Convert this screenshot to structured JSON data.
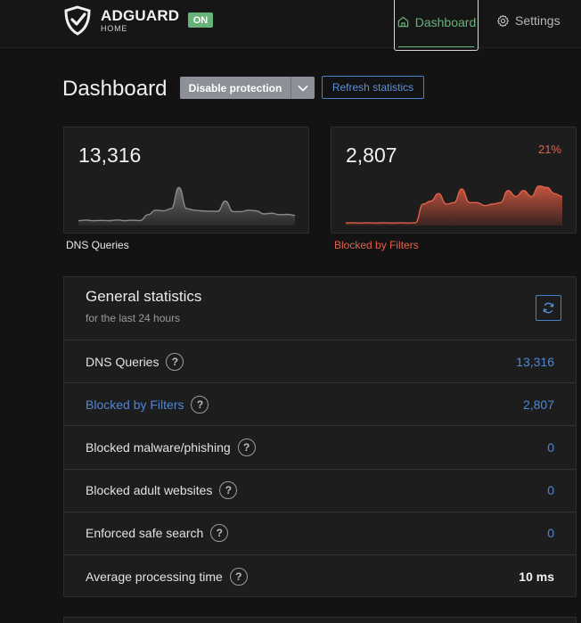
{
  "header": {
    "brand": "ADGUARD",
    "brand_sub": "HOME",
    "status_badge": "ON",
    "nav": {
      "dashboard": "Dashboard",
      "settings": "Settings"
    }
  },
  "page": {
    "title": "Dashboard",
    "disable_protection": "Disable protection",
    "refresh_statistics": "Refresh statistics"
  },
  "cards": {
    "dns": {
      "value": "13,316",
      "label": "DNS Queries",
      "color": "#9a9a9a"
    },
    "blocked": {
      "value": "2,807",
      "percent": "21%",
      "label": "Blocked by Filters",
      "color": "#e2604b"
    }
  },
  "general": {
    "title": "General statistics",
    "subtitle": "for the last 24 hours",
    "rows": [
      {
        "name": "DNS Queries",
        "value": "13,316",
        "name_color": "white",
        "value_color": "blue"
      },
      {
        "name": "Blocked by Filters",
        "value": "2,807",
        "name_color": "blue",
        "value_color": "blue"
      },
      {
        "name": "Blocked malware/phishing",
        "value": "0",
        "name_color": "white",
        "value_color": "blue"
      },
      {
        "name": "Blocked adult websites",
        "value": "0",
        "name_color": "white",
        "value_color": "blue"
      },
      {
        "name": "Enforced safe search",
        "value": "0",
        "name_color": "white",
        "value_color": "blue"
      },
      {
        "name": "Average processing time",
        "value": "10 ms",
        "name_color": "white",
        "value_color": "white"
      }
    ],
    "help_glyph": "?"
  },
  "colors": {
    "accent_green": "#67b279",
    "link_blue": "#467fcf",
    "danger": "#e2604b"
  },
  "chart_data": [
    {
      "type": "area",
      "series": [
        {
          "values": [
            2,
            2.4,
            2,
            2.2,
            2,
            2.5,
            2,
            2.3,
            2.1,
            6,
            9,
            8.5,
            10,
            24,
            10,
            9,
            8.5,
            8.3,
            8.2,
            15,
            8,
            8,
            9,
            8.5,
            6.5,
            7,
            6,
            6.2,
            5.5
          ]
        }
      ]
    },
    {
      "type": "area",
      "series": [
        {
          "values": [
            0.5,
            0.6,
            0.5,
            0.6,
            0.5,
            0.6,
            0.5,
            0.6,
            0.5,
            0.6,
            13,
            15,
            20,
            13,
            14,
            23,
            14,
            14,
            12,
            13,
            14,
            22,
            18,
            22,
            18,
            25,
            24,
            20,
            18
          ]
        }
      ]
    }
  ]
}
